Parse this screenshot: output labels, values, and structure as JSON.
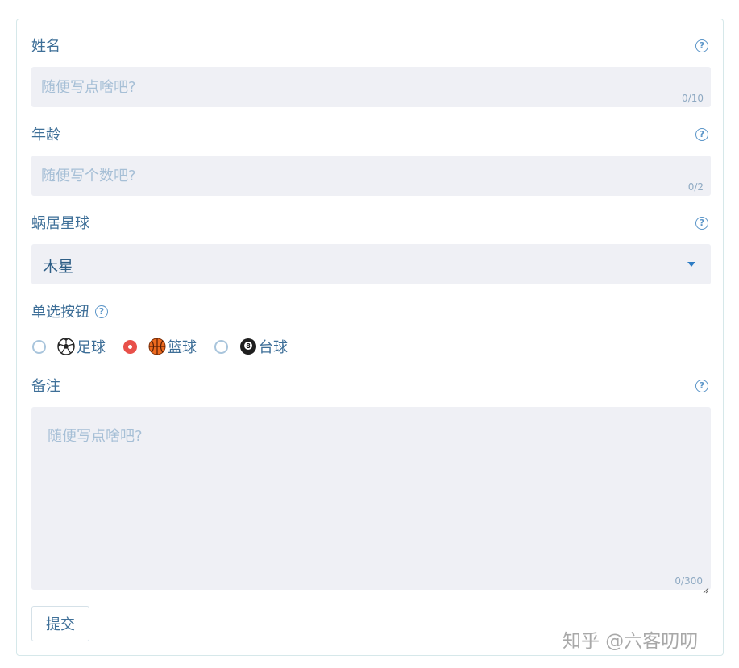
{
  "form": {
    "name": {
      "label": "姓名",
      "placeholder": "随便写点啥吧?",
      "counter": "0/10"
    },
    "age": {
      "label": "年龄",
      "placeholder": "随便写个数吧?",
      "counter": "0/2"
    },
    "planet": {
      "label": "蜗居星球",
      "value": "木星"
    },
    "radio": {
      "label": "单选按钮",
      "options": [
        {
          "label": "足球",
          "checked": false,
          "icon": "soccer-ball-icon"
        },
        {
          "label": "篮球",
          "checked": true,
          "icon": "basketball-icon"
        },
        {
          "label": "台球",
          "checked": false,
          "icon": "billiard-8-ball-icon"
        }
      ]
    },
    "remark": {
      "label": "备注",
      "placeholder": "随便写点啥吧?",
      "counter": "0/300"
    },
    "submit_label": "提交"
  },
  "watermark": "知乎 @六客叨叨",
  "colors": {
    "accent": "#e8504a",
    "field_bg": "#eff0f5",
    "label": "#3e6f98",
    "help_icon": "#5b95c8"
  }
}
